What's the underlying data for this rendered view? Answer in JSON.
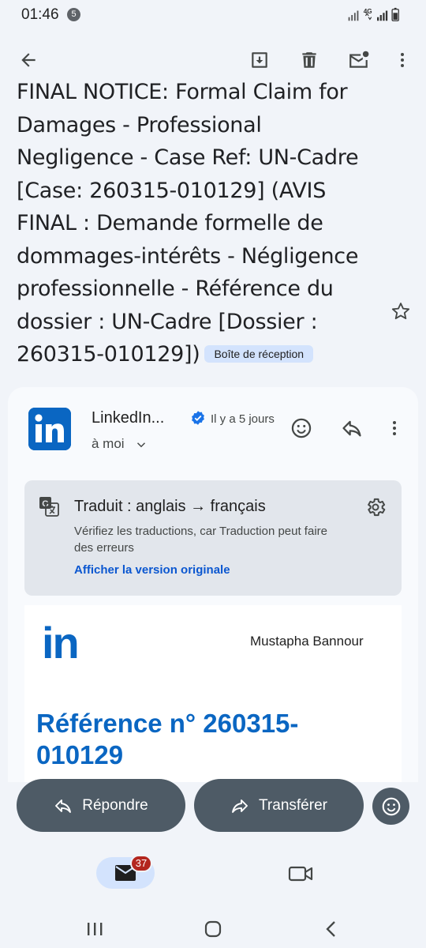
{
  "status_bar": {
    "time": "01:46",
    "notification_count": "5",
    "network": "4G"
  },
  "toolbar": {
    "back_icon": "arrow-back-icon",
    "archive_icon": "archive-icon",
    "delete_icon": "delete-icon",
    "mark_unread_icon": "mark-unread-icon",
    "more_icon": "more-vert-icon"
  },
  "email": {
    "subject": "FINAL NOTICE: Formal Claim for Damages - Professional Negligence - Case Ref: UN-Cadre [Case: 260315-010129] (AVIS FINAL : Demande formelle de dommages-intérêts - Négligence professionnelle - Référence du dossier : UN-Cadre [Dossier : 260315-010129])",
    "label": "Boîte de réception",
    "sender": "LinkedIn...",
    "date": "Il y a 5 jours",
    "recipient": "à moi"
  },
  "translation": {
    "title": "Traduit : anglais → français",
    "description": "Vérifiez les traductions, car Traduction peut faire des erreurs",
    "link": "Afficher la version originale"
  },
  "body": {
    "logo": "in",
    "recipient_name": "Mustapha Bannour",
    "reference": "Référence n° 260315-010129"
  },
  "actions": {
    "reply": "Répondre",
    "forward": "Transférer"
  },
  "bottom_nav": {
    "mail_badge": "37"
  },
  "colors": {
    "linkedin_blue": "#0a66c2",
    "chip_bg": "#d3e3fd",
    "pill_bg": "#4e5b66",
    "link_blue": "#0b57d0",
    "badge_red": "#b3261e"
  }
}
